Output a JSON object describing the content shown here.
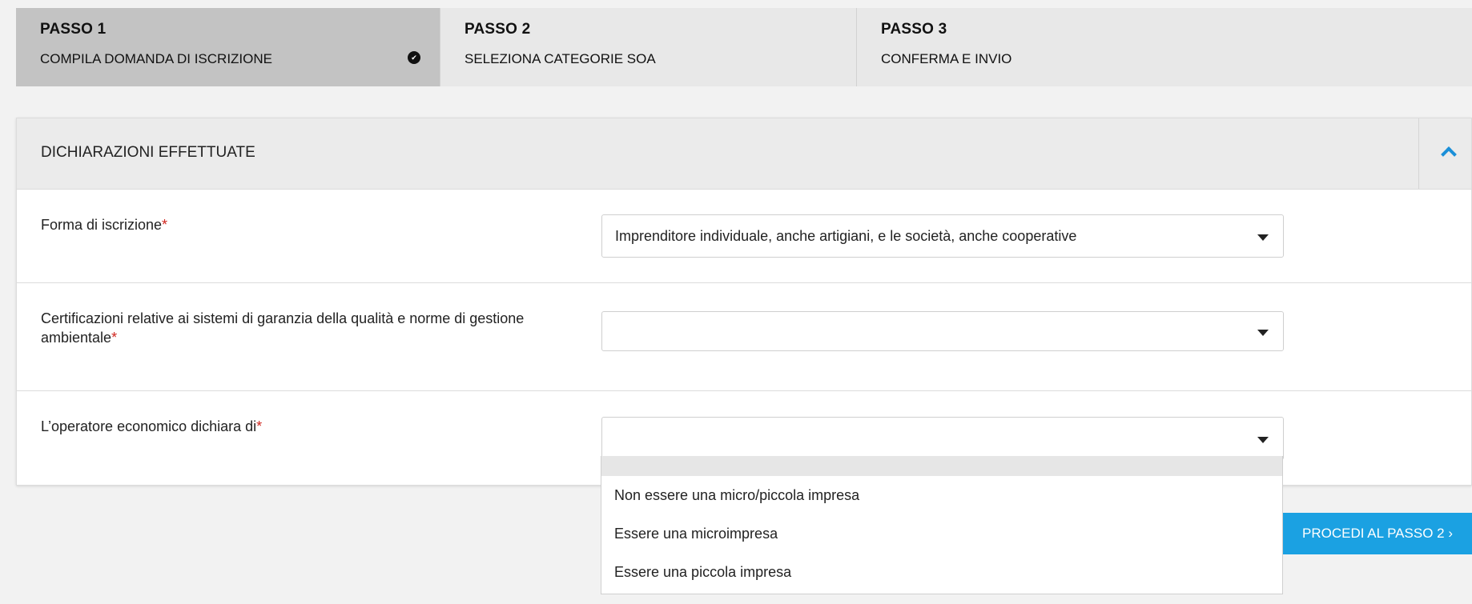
{
  "steps": [
    {
      "title": "PASSO 1",
      "subtitle": "COMPILA DOMANDA DI ISCRIZIONE",
      "active": true
    },
    {
      "title": "PASSO 2",
      "subtitle": "SELEZIONA CATEGORIE SOA",
      "active": false
    },
    {
      "title": "PASSO 3",
      "subtitle": "CONFERMA E INVIO",
      "active": false
    }
  ],
  "panel": {
    "title": "DICHIARAZIONI EFFETTUATE",
    "toggle_icon": "chevron-up-icon",
    "accent_color": "#1a8fd8"
  },
  "fields": [
    {
      "label": "Forma di iscrizione",
      "required_mark": "*",
      "value": "Imprenditore individuale, anche artigiani, e le società, anche cooperative"
    },
    {
      "label": "Certificazioni relative ai sistemi di garanzia della qualità e norme di gestione ambientale",
      "required_mark": "*",
      "value": ""
    },
    {
      "label": "L’operatore economico dichiara di",
      "required_mark": "*",
      "value": ""
    }
  ],
  "dropdown": {
    "options": [
      "",
      "Non essere una micro/piccola impresa",
      "Essere una microimpresa",
      "Essere una piccola impresa"
    ]
  },
  "proceed_button": {
    "label": "PROCEDI AL PASSO 2 ›",
    "color": "#1ba1e2"
  }
}
